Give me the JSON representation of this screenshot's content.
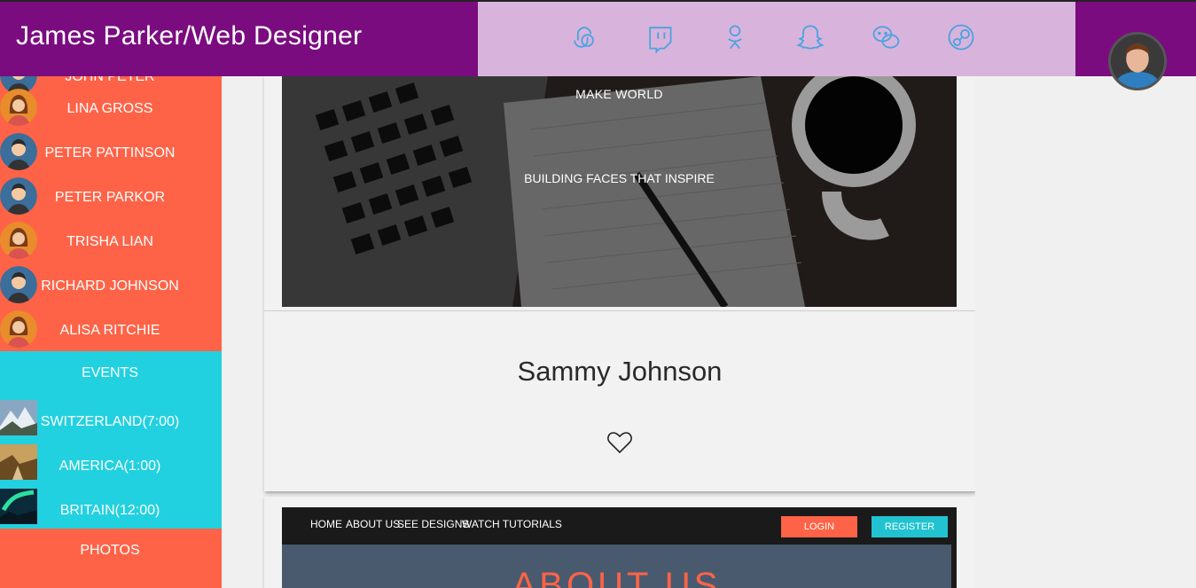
{
  "header": {
    "brand": "James Parker/Web Designer",
    "social_icons": [
      "stumbleupon-icon",
      "twitch-icon",
      "odnoklassniki-icon",
      "snapchat-icon",
      "wechat-icon",
      "steam-icon"
    ]
  },
  "sidebar": {
    "people": [
      {
        "name": "JOHN PETER",
        "gender": "male"
      },
      {
        "name": "LINA GROSS",
        "gender": "female"
      },
      {
        "name": "PETER PATTINSON",
        "gender": "male"
      },
      {
        "name": "PETER PARKOR",
        "gender": "male"
      },
      {
        "name": "TRISHA LIAN",
        "gender": "female"
      },
      {
        "name": "RICHARD JOHNSON",
        "gender": "male"
      },
      {
        "name": "ALISA RITCHIE",
        "gender": "female"
      }
    ],
    "events_title": "EVENTS",
    "events": [
      {
        "label": "SWITZERLAND(7:00)"
      },
      {
        "label": "AMERICA(1:00)"
      },
      {
        "label": "BRITAIN(12:00)"
      }
    ],
    "photos_title": "PHOTOS"
  },
  "main": {
    "hero_line1": "MAKE WORLD",
    "hero_line2": "BUILDING FACES THAT INSPIRE",
    "card_name": "Sammy Johnson",
    "preview": {
      "nav": [
        "HOME",
        "ABOUT US",
        "SEE DESIGNS",
        "WATCH TUTORIALS"
      ],
      "login": "LOGIN",
      "register": "REGISTER",
      "heading": "ABOUT US"
    }
  },
  "colors": {
    "header": "#7a0c80",
    "social_bar": "#d8b3dc",
    "sidebar": "#ff6347",
    "events": "#22d1e0",
    "social_icon": "#4aa3e0"
  }
}
